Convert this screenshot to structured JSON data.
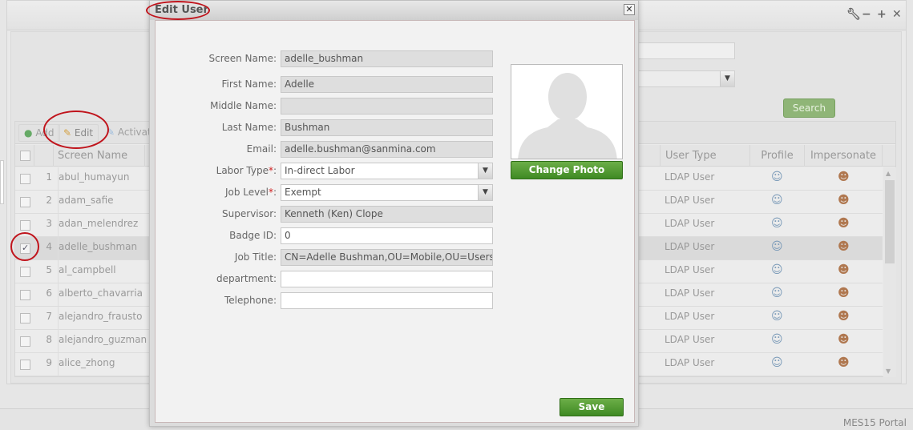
{
  "portal": {
    "window_controls": [
      "wrench",
      "minimize",
      "maximize",
      "close"
    ],
    "search_label": "Search",
    "footer": "MES15 Portal"
  },
  "toolbar": {
    "add": "Add",
    "edit": "Edit",
    "activate": "Activate"
  },
  "grid": {
    "columns": {
      "screen_name": "Screen Name",
      "user_type": "User Type",
      "profile": "Profile",
      "impersonate": "Impersonate"
    },
    "rows": [
      {
        "n": "1",
        "name": "abul_humayun",
        "type": "LDAP User",
        "checked": false
      },
      {
        "n": "2",
        "name": "adam_safie",
        "type": "LDAP User",
        "checked": false
      },
      {
        "n": "3",
        "name": "adan_melendrez",
        "type": "LDAP User",
        "checked": false
      },
      {
        "n": "4",
        "name": "adelle_bushman",
        "type": "LDAP User",
        "checked": true
      },
      {
        "n": "5",
        "name": "al_campbell",
        "type": "LDAP User",
        "checked": false
      },
      {
        "n": "6",
        "name": "alberto_chavarria",
        "type": "LDAP User",
        "checked": false
      },
      {
        "n": "7",
        "name": "alejandro_frausto",
        "type": "LDAP User",
        "checked": false
      },
      {
        "n": "8",
        "name": "alejandro_guzman",
        "type": "LDAP User",
        "checked": false
      },
      {
        "n": "9",
        "name": "alice_zhong",
        "type": "LDAP User",
        "checked": false
      }
    ]
  },
  "dialog": {
    "title": "Edit User",
    "fields": [
      {
        "label": "Screen Name:",
        "value": "adelle_bushman",
        "readonly": true
      },
      {
        "label": "First Name:",
        "value": "Adelle",
        "readonly": true
      },
      {
        "label": "Middle Name:",
        "value": "",
        "readonly": true
      },
      {
        "label": "Last Name:",
        "value": "Bushman",
        "readonly": true
      },
      {
        "label": "Email:",
        "value": "adelle.bushman@sanmina.com",
        "readonly": true
      },
      {
        "label": "Labor Type",
        "required": true,
        "value": "In-direct Labor",
        "select": true
      },
      {
        "label": "Job Level",
        "required": true,
        "value": "Exempt",
        "select": true
      },
      {
        "label": "Supervisor:",
        "value": "Kenneth (Ken) Clope",
        "readonly": true
      },
      {
        "label": "Badge ID:",
        "value": "0"
      },
      {
        "label": "Job Title:",
        "value": "CN=Adelle Bushman,OU=Mobile,OU=Users,OU=O",
        "readonly": true
      },
      {
        "label": "department:",
        "value": ""
      },
      {
        "label": "Telephone:",
        "value": ""
      }
    ],
    "change_photo": "Change Photo",
    "save": "Save"
  },
  "colors": {
    "accent_green": "#4e9a2f",
    "annotation_red": "#c0141c"
  }
}
